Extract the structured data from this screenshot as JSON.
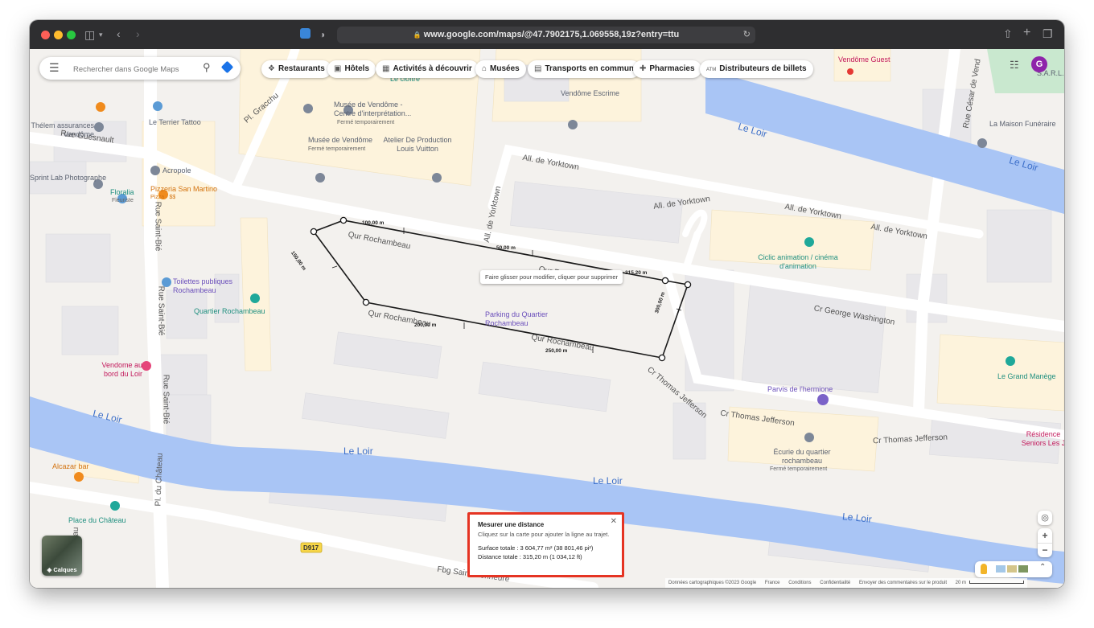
{
  "browser": {
    "url": "www.google.com/maps/@47.7902175,1.069558,19z?entry=ttu"
  },
  "search": {
    "placeholder": "Rechercher dans Google Maps"
  },
  "chips": [
    {
      "label": "Restaurants",
      "icon": "fork-knife-icon"
    },
    {
      "label": "Hôtels",
      "icon": "bed-icon"
    },
    {
      "label": "Activités à découvrir",
      "icon": "ticket-icon"
    },
    {
      "label": "Musées",
      "icon": "museum-icon"
    },
    {
      "label": "Transports en commun",
      "icon": "bus-icon"
    },
    {
      "label": "Pharmacies",
      "icon": "pharmacy-icon"
    },
    {
      "label": "Distributeurs de billets",
      "icon": "atm-icon"
    }
  ],
  "streets": {
    "rue_guesnault": "Rue Guesnault",
    "rue_saint_bie_1": "Rue Saint-Bié",
    "rue_saint_bie_2": "Rue Saint-Bié",
    "rue_saint_bie_3": "Rue Saint-Bié",
    "pl_gracchus": "Pl. Gracchu",
    "all_yorktown_1": "All. de Yorktown",
    "all_yorktown_2": "All. de Yorktown",
    "all_yorktown_3": "All. de Yorktown",
    "all_yorktown_4": "All. de Yorktown",
    "all_yorktown_v": "All. de Yorktown",
    "cur_rochambeau_1": "Qur Rochambeau",
    "cur_rochambeau_2": "Qur Rochambeau",
    "cur_rochambeau_3": "Qur Rochambeau",
    "cur_rochambeau_4": "Qur Rochambeau",
    "cr_george_washington": "Cr George Washington",
    "cr_thomas_jefferson_1": "Cr Thomas Jefferson",
    "cr_thomas_jefferson_2": "Cr Thomas Jefferson",
    "cr_thomas_jefferson_3": "Cr Thomas Jefferson",
    "pl_du_chateau": "Pl. du Château",
    "chateau": "Château",
    "fbg": "Fbg Saint-Lienheuré",
    "rue_cesar": "Rue César de Vend",
    "d917": "D917"
  },
  "rivers": {
    "loir_1": "Le Loir",
    "loir_2": "Le Loir",
    "loir_3": "Le Loir",
    "loir_4": "Le Loir",
    "loir_5": "Le Loir",
    "loir_6": "Le Loir"
  },
  "pois": {
    "vendome_guest": "Vendôme Guest",
    "sarl": "S.A.R.L.",
    "cloitre": "Le cloître",
    "thelem": "Thélem assurances Vendôme",
    "terrier": "Le Terrier Tattoo",
    "acropole": "Acropole",
    "musee1": "Musée de Vendôme - Centre d'interprétation...",
    "musee1_status": "Fermé temporairement",
    "musee2": "Musée de Vendôme",
    "musee2_status": "Fermé temporairement",
    "atelier": "Atelier De Production Louis Vuitton",
    "escrime": "Vendôme Escrime",
    "maison_funeraire": "La Maison Funéraire",
    "sprint": "Sprint Lab Photographe",
    "floralia": "Floralia",
    "floralia_sub": "Fleuriste",
    "pizzeria": "Pizzeria San Martino",
    "pizzeria_sub": "Pizza · $$",
    "ciclic": "Ciclic animation / cinéma d'animation",
    "toilettes": "Toilettes publiques Rochambeau",
    "quartier_rochambeau": "Quartier Rochambeau",
    "parking": "Parking du Quartier Rochambeau",
    "vendome_loir": "Vendome au bord du Loir",
    "grand_manege": "Le Grand Manège",
    "parvis": "Parvis de l'hermione",
    "ecurie": "Écurie du quartier rochambeau",
    "ecurie_status": "Fermé temporairement",
    "residence": "Résidence Seniors Les J",
    "alcazar": "Alcazar bar",
    "place_chateau": "Place du Château"
  },
  "measurement_labels": [
    "100,00 m",
    "50,00 m",
    "315,20 m",
    "300,00 m",
    "250,00 m",
    "200,00 m",
    "150,00 m"
  ],
  "tooltip": "Faire glisser pour modifier, cliquer pour supprimer",
  "measure_card": {
    "title": "Mesurer une distance",
    "subtitle": "Cliquez sur la carte pour ajouter la ligne au trajet.",
    "surface": "Surface totale : 3 604,77 m² (38 801,46 pi²)",
    "distance": "Distance totale : 315,20 m (1 034,12 ft)"
  },
  "layers_label": "Calques",
  "avatar_letter": "G",
  "footer": {
    "data": "Données cartographiques ©2023 Google",
    "country": "France",
    "conditions": "Conditions",
    "privacy": "Confidentialité",
    "feedback": "Envoyer des commentaires sur le produit",
    "scale": "20 m"
  },
  "colors": {
    "water": "#a9c5f5",
    "building": "#fdf3dc",
    "road": "#ffffff",
    "highlight": "#e53423"
  }
}
